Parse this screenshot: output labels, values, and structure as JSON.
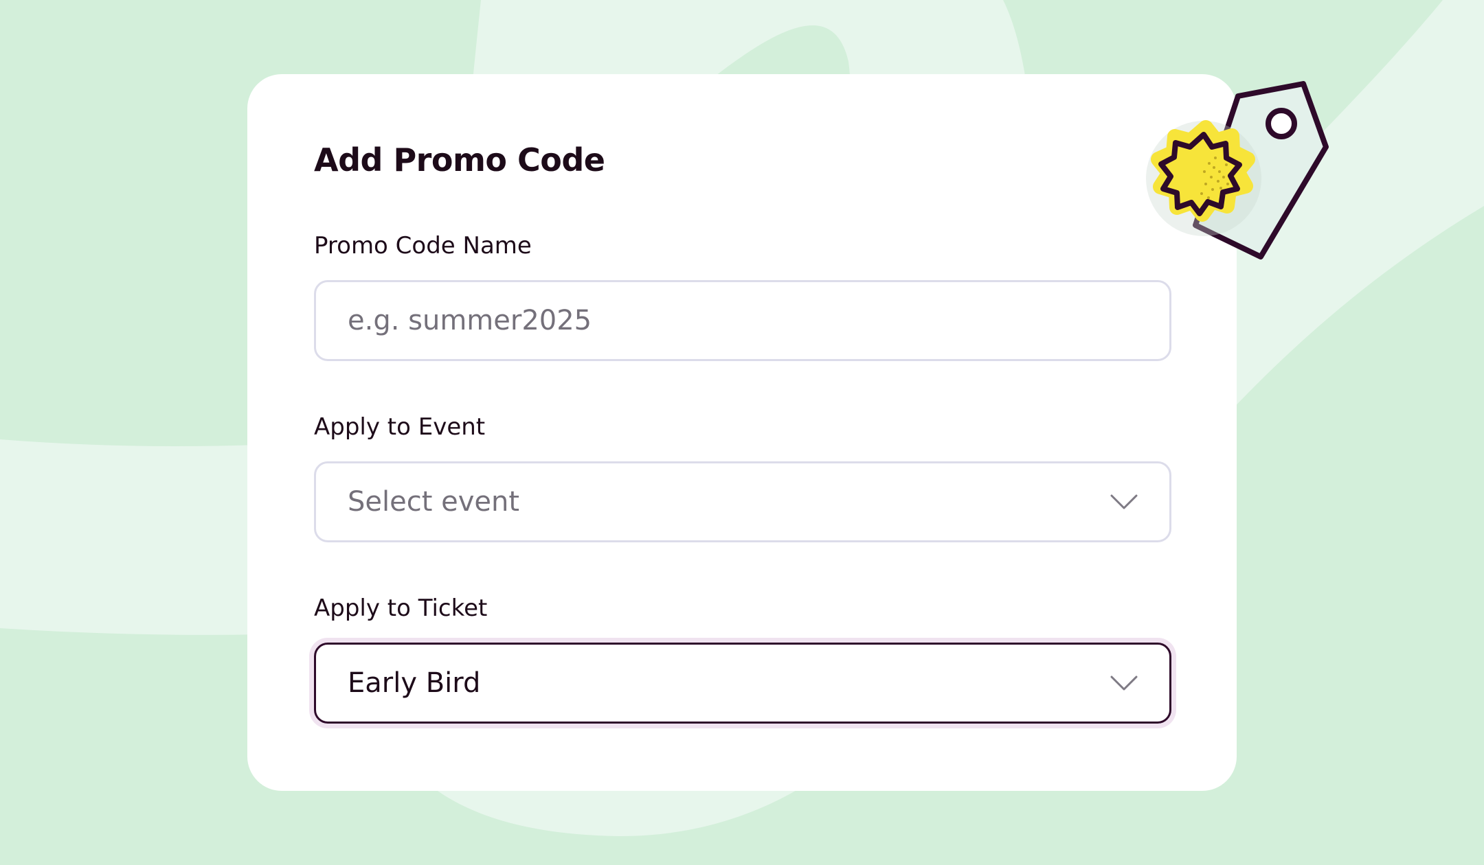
{
  "form": {
    "title": "Add Promo Code",
    "promo_code_name": {
      "label": "Promo Code Name",
      "placeholder": "e.g. summer2025",
      "value": ""
    },
    "apply_to_event": {
      "label": "Apply to Event",
      "placeholder": "Select event",
      "icon": "chevron-down-icon"
    },
    "apply_to_ticket": {
      "label": "Apply to Ticket",
      "selected": "Early Bird",
      "icon": "chevron-down-icon"
    }
  },
  "illustration": {
    "icon": "price-tag-icon",
    "badge_icon": "starburst-badge-icon"
  },
  "colors": {
    "background": "#d3efda",
    "card": "#ffffff",
    "text": "#1d0b19",
    "placeholder": "#74707a",
    "field_border": "#dcdcea",
    "active_border": "#2e0a2a",
    "badge_yellow": "#f7e43a"
  }
}
